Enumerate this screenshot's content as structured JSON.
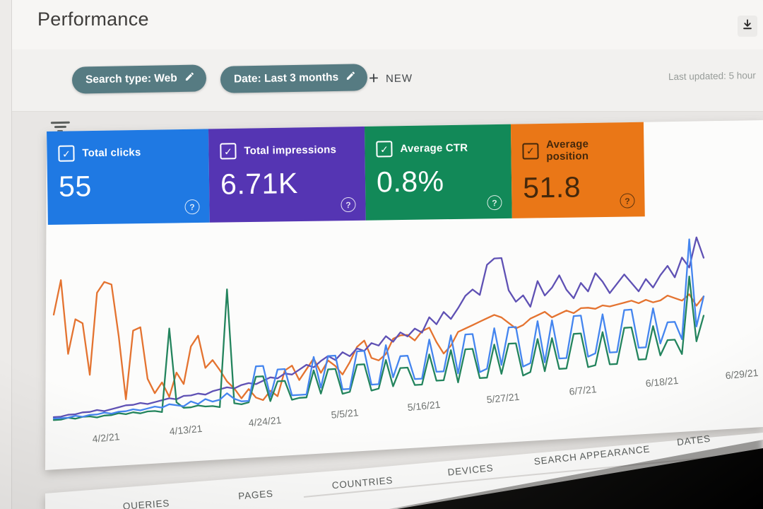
{
  "header": {
    "title": "Performance"
  },
  "filters": {
    "chips": [
      {
        "label": "Search type: Web"
      },
      {
        "label": "Date: Last 3 months"
      }
    ],
    "new_button": {
      "plus": "+",
      "label": "NEW"
    },
    "last_updated": "Last updated: 5 hour",
    "chip_color": "#557b83"
  },
  "metrics": [
    {
      "label": "Total clicks",
      "value": "55",
      "color": "#1c79e8",
      "text_color": "#ffffff",
      "checked": true
    },
    {
      "label": "Total impressions",
      "value": "6.71K",
      "color": "#5634b8",
      "text_color": "#ffffff",
      "checked": true
    },
    {
      "label": "Average CTR",
      "value": "0.8%",
      "color": "#0e8a57",
      "text_color": "#ffffff",
      "checked": true
    },
    {
      "label": "Average position",
      "value": "51.8",
      "color": "#ee7612",
      "text_color": "#46280a",
      "checked": true
    }
  ],
  "help_glyph": "?",
  "check_glyph": "✓",
  "chart_data": {
    "type": "line",
    "x_tick_labels": [
      "4/2/21",
      "4/13/21",
      "4/24/21",
      "5/5/21",
      "5/16/21",
      "5/27/21",
      "6/7/21",
      "6/18/21",
      "6/29/21"
    ],
    "x_range_days": 91,
    "tick_day_indices": [
      1,
      12,
      23,
      34,
      45,
      56,
      67,
      78,
      89
    ],
    "ylim": [
      0,
      100
    ],
    "grid": false,
    "legend": "none (series match metric card colors)",
    "series": [
      {
        "name": "Total clicks",
        "color": "#4285f4",
        "values": [
          2,
          2,
          2,
          3,
          2,
          3,
          3,
          4,
          3,
          4,
          4,
          5,
          4,
          5,
          6,
          5,
          7,
          6,
          5,
          8,
          6,
          9,
          7,
          8,
          12,
          8,
          6,
          6,
          29,
          29,
          8,
          26,
          26,
          8,
          8,
          8,
          33,
          12,
          33,
          33,
          10,
          10,
          35,
          35,
          12,
          12,
          38,
          16,
          30,
          30,
          14,
          14,
          40,
          18,
          18,
          42,
          16,
          42,
          42,
          16,
          18,
          45,
          20,
          45,
          45,
          18,
          20,
          48,
          20,
          48,
          22,
          22,
          50,
          50,
          22,
          24,
          50,
          24,
          24,
          52,
          52,
          26,
          26,
          52,
          28,
          42,
          42,
          30,
          97,
          38,
          58
        ]
      },
      {
        "name": "Total impressions",
        "color": "#5f51b8",
        "values": [
          3,
          3,
          4,
          4,
          5,
          5,
          6,
          5,
          6,
          7,
          8,
          8,
          9,
          8,
          9,
          10,
          11,
          10,
          12,
          12,
          13,
          12,
          14,
          15,
          16,
          15,
          17,
          18,
          17,
          19,
          21,
          20,
          23,
          22,
          25,
          28,
          26,
          30,
          33,
          30,
          35,
          32,
          37,
          35,
          40,
          38,
          44,
          40,
          46,
          43,
          48,
          45,
          55,
          50,
          58,
          53,
          60,
          68,
          72,
          68,
          88,
          92,
          92,
          70,
          62,
          66,
          58,
          75,
          65,
          70,
          78,
          68,
          62,
          72,
          66,
          78,
          72,
          64,
          70,
          76,
          70,
          64,
          72,
          66,
          74,
          80,
          72,
          85,
          78,
          98,
          84
        ]
      },
      {
        "name": "Average CTR",
        "color": "#20855c",
        "values": [
          1,
          1,
          2,
          1,
          2,
          2,
          1,
          2,
          2,
          3,
          2,
          3,
          2,
          3,
          3,
          2,
          58,
          8,
          4,
          4,
          5,
          4,
          4,
          3,
          82,
          5,
          4,
          5,
          22,
          22,
          5,
          18,
          18,
          5,
          6,
          6,
          24,
          8,
          24,
          24,
          7,
          8,
          26,
          26,
          8,
          9,
          28,
          10,
          22,
          22,
          10,
          10,
          30,
          12,
          12,
          32,
          10,
          32,
          32,
          12,
          12,
          34,
          14,
          34,
          34,
          12,
          14,
          36,
          14,
          36,
          15,
          15,
          38,
          38,
          15,
          16,
          38,
          16,
          16,
          40,
          40,
          18,
          18,
          40,
          20,
          30,
          30,
          20,
          72,
          28,
          45
        ]
      },
      {
        "name": "Average position",
        "color": "#e8722c",
        "values": [
          72,
          95,
          45,
          68,
          65,
          30,
          85,
          92,
          90,
          55,
          12,
          58,
          60,
          25,
          15,
          22,
          12,
          28,
          20,
          45,
          52,
          30,
          35,
          28,
          20,
          15,
          8,
          14,
          8,
          6,
          12,
          8,
          25,
          28,
          18,
          25,
          32,
          22,
          30,
          26,
          20,
          28,
          38,
          42,
          30,
          28,
          32,
          42,
          44,
          44,
          40,
          46,
          48,
          38,
          30,
          35,
          44,
          46,
          48,
          50,
          52,
          54,
          52,
          48,
          44,
          46,
          50,
          52,
          54,
          50,
          52,
          54,
          52,
          55,
          55,
          54,
          56,
          55,
          56,
          57,
          58,
          56,
          58,
          56,
          57,
          60,
          58,
          56,
          60,
          52,
          58
        ]
      }
    ]
  },
  "tabs": [
    "QUERIES",
    "PAGES",
    "COUNTRIES",
    "DEVICES",
    "SEARCH APPEARANCE",
    "DATES"
  ]
}
